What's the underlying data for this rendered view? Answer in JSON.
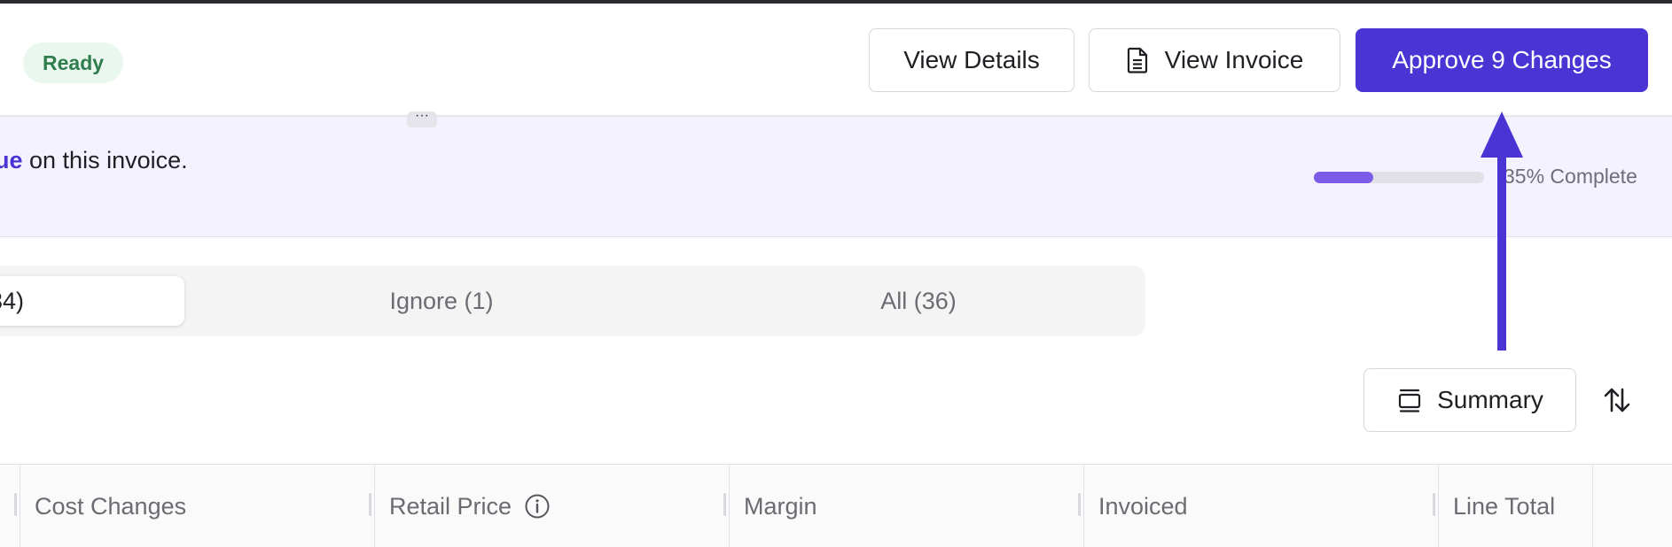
{
  "header": {
    "status": "Ready",
    "view_details_label": "View Details",
    "view_invoice_label": "View Invoice",
    "approve_label": "Approve 9 Changes"
  },
  "banner": {
    "text_link": "ue",
    "text_rest": " on this invoice.",
    "progress_percent": 35,
    "progress_label": "35% Complete"
  },
  "filters": {
    "active_label": "34)",
    "ignore_label": "Ignore (1)",
    "all_label": "All (36)"
  },
  "toolbar": {
    "summary_label": "Summary"
  },
  "table": {
    "columns": [
      "Cost Changes",
      "Retail Price",
      "Margin",
      "Invoiced",
      "Line Total"
    ]
  },
  "colors": {
    "accent": "#4a34d4",
    "badge_bg": "#eaf7ee",
    "badge_text": "#2f7d4d",
    "progress_fill": "#7b5ce8"
  },
  "icons": {
    "invoice": "document-icon",
    "summary": "summary-icon",
    "sort": "sort-arrows-icon",
    "info": "info-icon",
    "handle": "more-dots-icon",
    "annotation": "up-arrow-annotation"
  }
}
